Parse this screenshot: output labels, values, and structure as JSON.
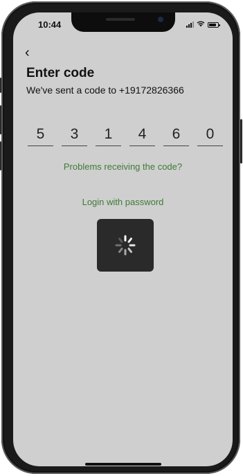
{
  "status_bar": {
    "time": "10:44",
    "battery_level": 0.85,
    "icons": [
      "signal-icon",
      "wifi-icon",
      "battery-icon"
    ]
  },
  "nav": {
    "back_icon": "chevron-left-icon",
    "back_glyph": "‹"
  },
  "header": {
    "title": "Enter code",
    "subtitle": "We've sent a code to +19172826366"
  },
  "code": {
    "digits": [
      "5",
      "3",
      "1",
      "4",
      "6",
      "0"
    ]
  },
  "links": {
    "problems": "Problems receiving the code?",
    "login_password": "Login with password"
  },
  "loading": {
    "icon": "spinner-icon",
    "visible": true
  },
  "colors": {
    "background": "#cfcfcf",
    "accent": "#3f7a37",
    "text": "#111111",
    "overlay": "#2a2a2a"
  }
}
